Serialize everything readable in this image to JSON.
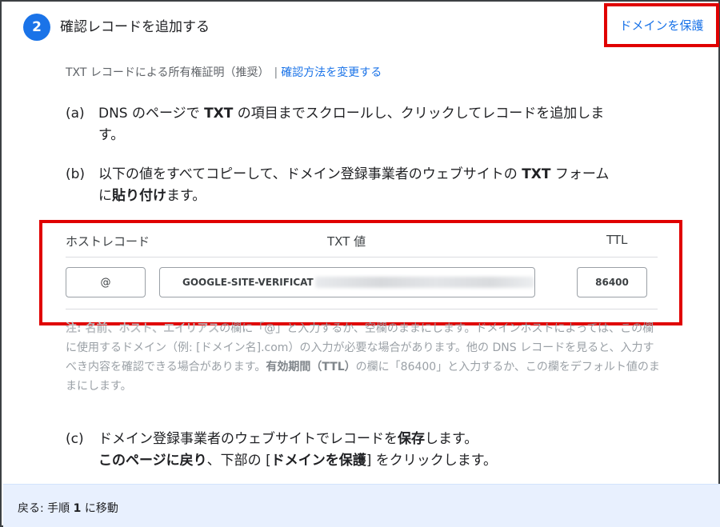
{
  "step": {
    "number": "2",
    "title": "確認レコードを追加する"
  },
  "method": {
    "label": "TXT レコードによる所有権証明（推奨）",
    "separator": "|",
    "change_link": "確認方法を変更する"
  },
  "instructions": {
    "a": {
      "marker": "(a)",
      "pre": "DNS のページで ",
      "bold1": "TXT",
      "mid": " の項目までスクロールし、クリックしてレコードを追加しま",
      "line2": "す。"
    },
    "b": {
      "marker": "(b)",
      "pre": "以下の値をすべてコピーして、ドメイン登録事業者のウェブサイトの ",
      "bold1": "TXT",
      "mid": " フォーム",
      "line2_pre": "に",
      "line2_bold": "貼り付け",
      "line2_post": "ます。"
    },
    "c": {
      "marker": "(c)",
      "pre": "ドメイン登録事業者のウェブサイトでレコードを",
      "bold1": "保存",
      "post": "します。",
      "line2_bold": "このページに戻り",
      "line2_mid": "、下部の [",
      "line2_bold2": "ドメインを保護",
      "line2_post": "] をクリックします。"
    }
  },
  "record_table": {
    "headers": {
      "host": "ホストレコード",
      "txt": "TXT 値",
      "ttl": "TTL"
    },
    "values": {
      "host": "@",
      "txt": "GOOGLE-SITE-VERIFICAT",
      "ttl": "86400"
    }
  },
  "note": {
    "p1_bold": "注: 名前、ホスト、エイリアス",
    "p1_text": "の欄に「@」と入力するか、空欄のままにします。ドメインホストによっては、この欄に使用するドメイン（例: [ドメイン名].com）の入力が必要な場合があります。他の DNS レコードを見ると、入力すべき内容を確認できる場合があります。",
    "p2_bold": "有効期間（TTL）",
    "p2_text": "の欄に「86400」と入力するか、この欄をデフォルト値のままにします。"
  },
  "footer": {
    "back_pre": "戻る: 手順 ",
    "back_num": "1",
    "back_post": " に移動",
    "protect_button": "ドメインを保護"
  },
  "colors": {
    "accent": "#1a73e8",
    "highlight": "#e00000",
    "footer_bg": "#e8f0fe"
  }
}
